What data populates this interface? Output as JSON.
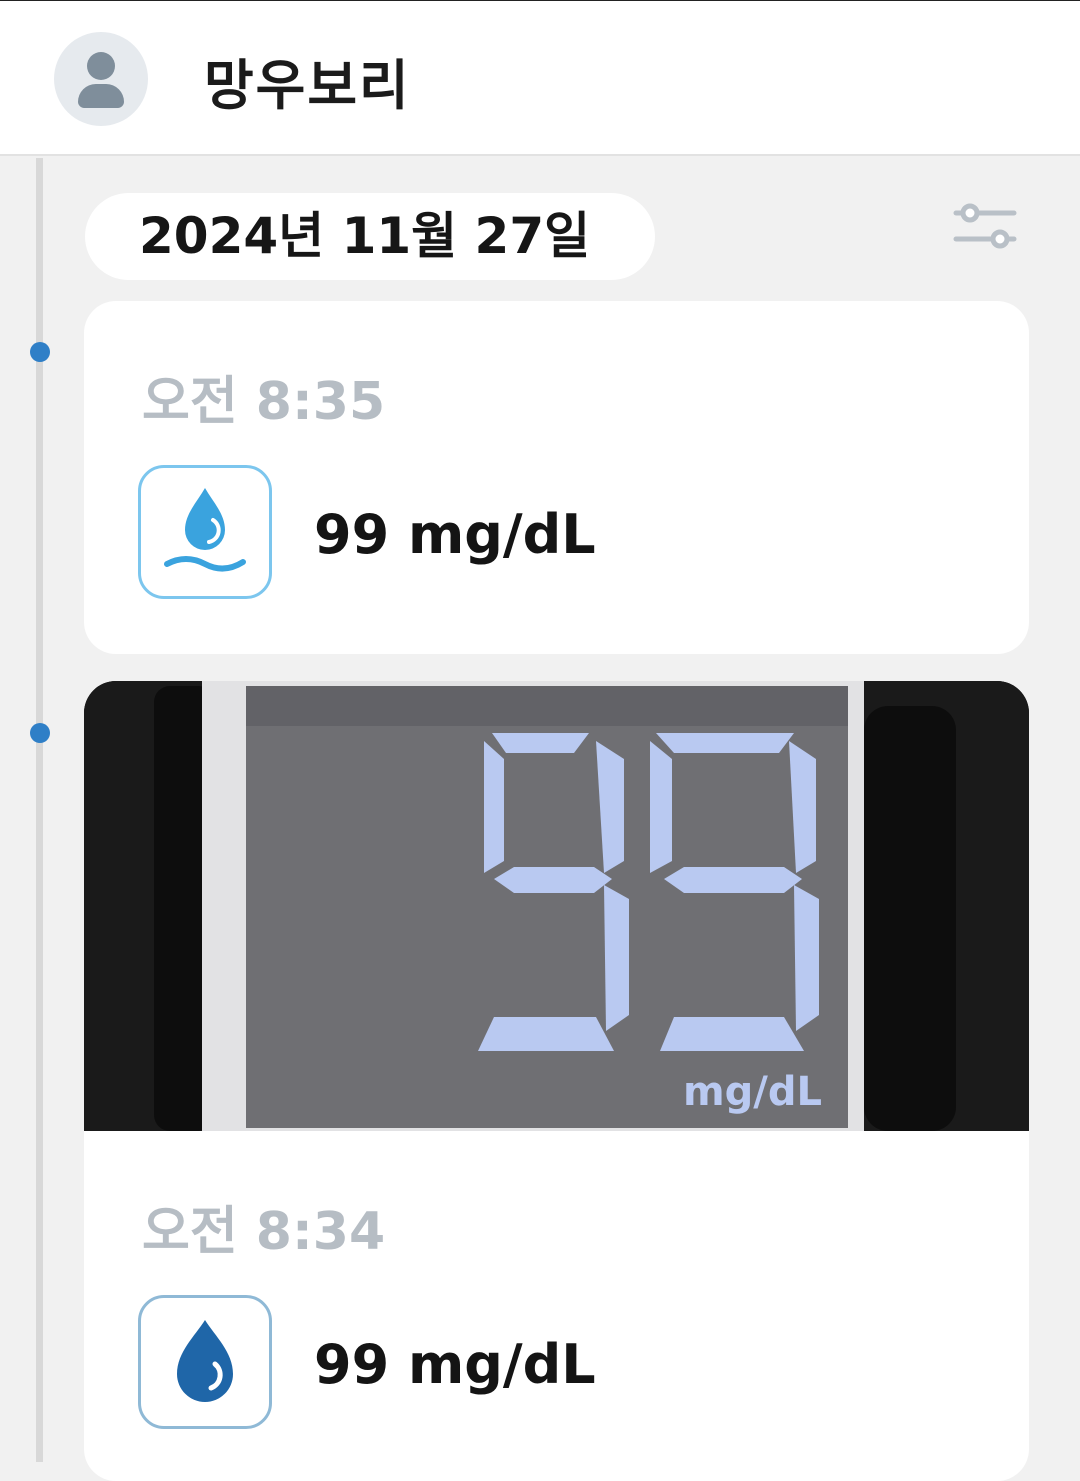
{
  "header": {
    "profile_name": "망우보리"
  },
  "timeline": {
    "date": "2024년 11월 27일",
    "entries": [
      {
        "time": "오전 8:35",
        "reading": "99 mg/dL",
        "icon": "water-drop-waves-icon"
      },
      {
        "time": "오전 8:34",
        "reading": "99 mg/dL",
        "icon": "water-drop-icon",
        "photo": {
          "meter_digits": "99",
          "meter_unit": "mg/dL"
        }
      }
    ]
  },
  "colors": {
    "accent": "#2f7fc7",
    "time_text": "#b6bdc4",
    "background": "#f1f1f1"
  }
}
